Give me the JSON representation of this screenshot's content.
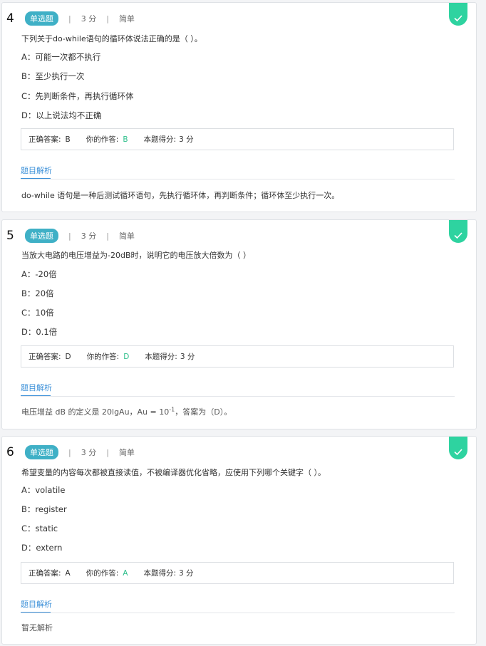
{
  "accent_color": "#3fb0c6",
  "correct_color": "#2ed3a0",
  "link_color": "#3a8fd8",
  "questions": [
    {
      "number": "4",
      "type": "单选题",
      "score": "3 分",
      "difficulty": "简单",
      "stem": "下列关于do-while语句的循环体说法正确的是（   ）。",
      "options": [
        {
          "key": "A：",
          "text": "可能一次都不执行"
        },
        {
          "key": "B：",
          "text": "至少执行一次"
        },
        {
          "key": "C：",
          "text": "先判断条件，再执行循环体"
        },
        {
          "key": "D：",
          "text": "以上说法均不正确"
        }
      ],
      "correct_label": "正确答案:",
      "correct_value": "B",
      "your_label": "你的作答:",
      "your_value": "B",
      "score_label": "本题得分:",
      "score_value": "3 分",
      "tab": "题目解析",
      "explanation": "do-while 语句是一种后测试循环语句，先执行循环体，再判断条件；循环体至少执行一次。"
    },
    {
      "number": "5",
      "type": "单选题",
      "score": "3 分",
      "difficulty": "简单",
      "stem": "当放大电路的电压增益为-20dB时，说明它的电压放大倍数为（    ）",
      "options": [
        {
          "key": "A：",
          "text": "-20倍"
        },
        {
          "key": "B：",
          "text": "20倍"
        },
        {
          "key": "C：",
          "text": "10倍"
        },
        {
          "key": "D：",
          "text": "0.1倍"
        }
      ],
      "correct_label": "正确答案:",
      "correct_value": "D",
      "your_label": "你的作答:",
      "your_value": "D",
      "score_label": "本题得分:",
      "score_value": "3 分",
      "tab": "题目解析",
      "explanation_pre": "电压增益 dB 的定义是 20lgAu，Au = 10",
      "explanation_sup": "-1",
      "explanation_post": "，答案为（D）。"
    },
    {
      "number": "6",
      "type": "单选题",
      "score": "3 分",
      "difficulty": "简单",
      "stem": "希望变量的内容每次都被直接读值，不被编译器优化省略，应使用下列哪个关键字（  ）。",
      "options": [
        {
          "key": "A：",
          "text": "volatile"
        },
        {
          "key": "B：",
          "text": "register"
        },
        {
          "key": "C：",
          "text": "static"
        },
        {
          "key": "D：",
          "text": "extern"
        }
      ],
      "correct_label": "正确答案:",
      "correct_value": "A",
      "your_label": "你的作答:",
      "your_value": "A",
      "score_label": "本题得分:",
      "score_value": "3 分",
      "tab": "题目解析",
      "explanation": "暂无解析"
    }
  ]
}
